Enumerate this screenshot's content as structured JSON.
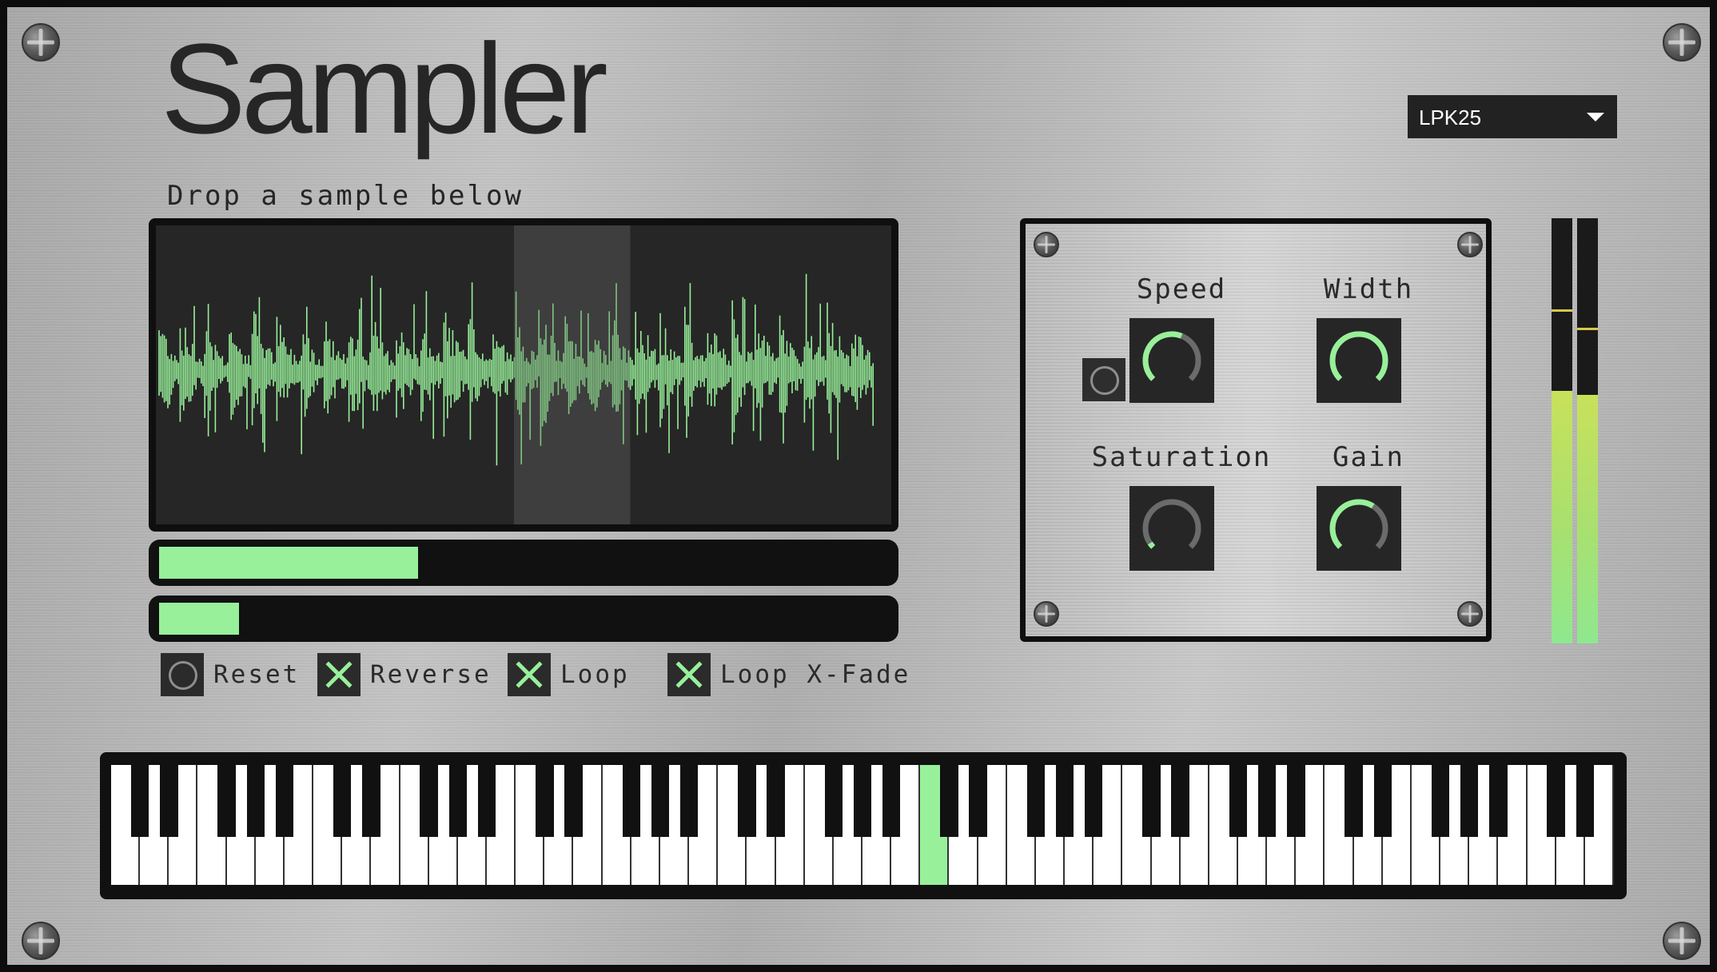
{
  "app": {
    "title": "Sampler",
    "subtitle": "Drop a sample below"
  },
  "device_select": {
    "selected": "LPK25"
  },
  "waveform": {
    "color": "#98f09a",
    "background": "#262626",
    "selection_color": "#3e3e3e",
    "selection_start": 0.487,
    "selection_end": 0.645
  },
  "sliders": [
    {
      "name": "sample-start",
      "value": 0.355
    },
    {
      "name": "sample-end",
      "value": 0.11
    }
  ],
  "toggles": [
    {
      "label": "Reset",
      "checked": false
    },
    {
      "label": "Reverse",
      "checked": true
    },
    {
      "label": "Loop",
      "checked": true
    },
    {
      "label": "Loop X-Fade",
      "checked": true
    }
  ],
  "knobs": [
    {
      "label": "Speed",
      "value": 0.58
    },
    {
      "label": "Width",
      "value": 1.0
    },
    {
      "label": "Saturation",
      "value": 0.04
    },
    {
      "label": "Gain",
      "value": 0.62
    }
  ],
  "meter": {
    "left_level": 0.66,
    "right_level": 0.65,
    "left_peak": 0.66,
    "right_peak": 0.72
  },
  "keyboard": {
    "white_keys": 52,
    "active_white_key": 28,
    "accent": "#98f09a"
  },
  "colors": {
    "accent": "#98f09a",
    "panel_dark": "#262626"
  }
}
